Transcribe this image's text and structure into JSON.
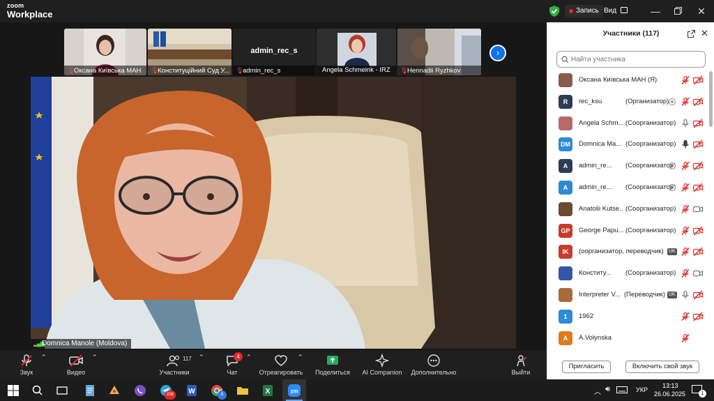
{
  "app": {
    "brand_top": "zoom",
    "brand_bottom": "Workplace"
  },
  "titlebar": {
    "recording_label": "Запись",
    "view_label": "Вид"
  },
  "thumbnails": [
    {
      "name": "Оксана Київська МАН",
      "muted": true
    },
    {
      "name": "Конституційний Суд У...",
      "muted": true
    },
    {
      "name": "admin_rec_s",
      "big_name": "admin_rec_s",
      "muted": true
    },
    {
      "name": "Angela Schmeink - IRZ",
      "muted": false
    },
    {
      "name": "Hennadii Ryzhkov",
      "muted": true
    }
  ],
  "active_speaker": {
    "name": "Domnica Manole (Moldova)"
  },
  "toolbar": {
    "audio": "Звук",
    "video": "Видео",
    "participants": "Участники",
    "participants_count": "117",
    "chat": "Чат",
    "chat_badge": "4",
    "react": "Отреагировать",
    "share": "Поделиться",
    "ai": "AI Companion",
    "more": "Дополнительно",
    "leave": "Выйти"
  },
  "panel": {
    "title": "Участники (117)",
    "search_placeholder": "Найти участника",
    "invite": "Пригласить",
    "unmute": "Включить свой звук",
    "participants": [
      {
        "name": "Оксана Київська МАН (Я)",
        "role": "",
        "avatar": "",
        "avatar_color": "#8a5a4a",
        "mic": "muted",
        "cam": "off"
      },
      {
        "name": "rec_ksu",
        "role": "(Организатор)",
        "avatar": "R",
        "avatar_color": "#2e3d55",
        "mic": "muted",
        "cam": "off",
        "extra": "record"
      },
      {
        "name": "Angela Schm...",
        "role": "(Соорганизатор)",
        "avatar": "",
        "avatar_color": "#b86a6a",
        "mic": "on",
        "cam": "off"
      },
      {
        "name": "Domnica Ma...",
        "role": "(Соорганизатор)",
        "avatar": "DM",
        "avatar_color": "#2d8ad6",
        "mic": "on-active",
        "cam": "off"
      },
      {
        "name": "admin_re...",
        "role": "(Соорганизатор)",
        "avatar": "A",
        "avatar_color": "#2e3d55",
        "mic": "muted",
        "cam": "off",
        "extra": "record"
      },
      {
        "name": "admin_re...",
        "role": "(Соорганизатор)",
        "avatar": "A",
        "avatar_color": "#2d8ad6",
        "mic": "muted",
        "cam": "off",
        "extra": "record"
      },
      {
        "name": "Anatolii Kutse...",
        "role": "(Соорганизатор)",
        "avatar": "",
        "avatar_color": "#6b4a2e",
        "mic": "muted",
        "cam": "on"
      },
      {
        "name": "George Papu...",
        "role": "(Соорганизатор)",
        "avatar": "GP",
        "avatar_color": "#c83a2a",
        "mic": "muted",
        "cam": "off"
      },
      {
        "name": "(оорганизатор, переводчик)",
        "role": "",
        "avatar": "IK",
        "avatar_color": "#c83a2a",
        "mic": "muted",
        "cam": "off",
        "extra": "uk"
      },
      {
        "name": "Конститу...",
        "role": "(Соорганизатор)",
        "avatar": "",
        "avatar_color": "#3355aa",
        "mic": "muted",
        "cam": "on"
      },
      {
        "name": "Interpreter V...",
        "role": "(Переводчик)",
        "avatar": "",
        "avatar_color": "#a86a3a",
        "mic": "on",
        "cam": "off",
        "extra": "uk"
      },
      {
        "name": "1962",
        "role": "",
        "avatar": "1",
        "avatar_color": "#2d8ad6",
        "mic": "muted",
        "cam": "off"
      },
      {
        "name": "A.Volynska",
        "role": "",
        "avatar": "A",
        "avatar_color": "#e07a1a",
        "mic": "muted",
        "cam": "none"
      }
    ]
  },
  "taskbar": {
    "badges": {
      "telegram": "236",
      "chrome": "8"
    },
    "lang": "УКР",
    "time": "13:13",
    "date": "26.06.2025",
    "notif_count": "1"
  }
}
